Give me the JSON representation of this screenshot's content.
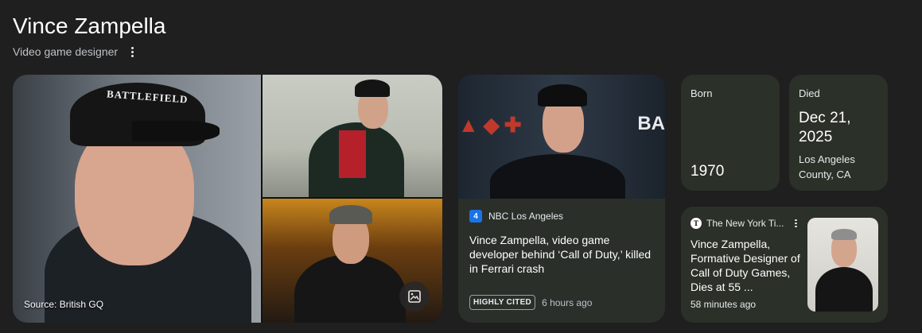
{
  "header": {
    "title": "Vince Zampella",
    "subtitle": "Video game designer"
  },
  "collage": {
    "source": "Source: British GQ",
    "cap_text": "BATTLEFIELD"
  },
  "news_card_1": {
    "source_logo": "4",
    "source": "NBC Los Angeles",
    "headline": "Vince Zampella, video game developer behind ‘Call of Duty,’ killed in Ferrari crash",
    "badge": "HIGHLY CITED",
    "time": "6 hours ago",
    "image_text_right": "BA"
  },
  "born": {
    "label": "Born",
    "value": "1970"
  },
  "died": {
    "label": "Died",
    "date": "Dec 21, 2025",
    "place": "Los Angeles County, CA"
  },
  "news_card_2": {
    "source": "The New York Ti...",
    "source_logo": "T",
    "headline": "Vince Zampella, Formative Designer of Call of Duty Games, Dies at 55 ...",
    "time": "58 minutes ago"
  },
  "colors": {
    "background": "#1f1f1f",
    "card": "#2b3028",
    "accent_blue": "#1a73e8"
  },
  "icons": [
    "more-vert-icon",
    "image-gallery-icon",
    "nbc4-logo-icon",
    "nyt-logo-icon"
  ]
}
